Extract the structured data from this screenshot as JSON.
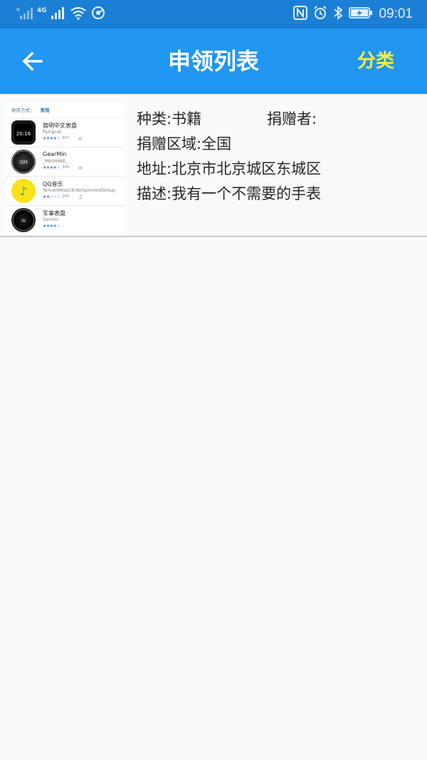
{
  "status_bar": {
    "network": "4G",
    "time": "09:01",
    "icons": [
      "signal-off-icon",
      "signal-icon",
      "wifi-icon",
      "hotspot-icon",
      "nfc-icon",
      "alarm-icon",
      "bluetooth-icon",
      "battery-charging-icon"
    ]
  },
  "app_bar": {
    "title": "申领列表",
    "category_label": "分类",
    "back_icon": "arrow-back-icon",
    "color": "#2196f3",
    "category_color": "#ffeb3b"
  },
  "list": [
    {
      "category": "种类:书籍",
      "donor": "捐赠者:",
      "region": "捐赠区域:全国",
      "address": "地址:北京市北京城区东城区",
      "description": "描述:我有一个不需要的手表",
      "thumbnail": {
        "sort_label": "排序方式：",
        "sort_value": "常用",
        "apps": [
          {
            "name": "简明中文表盘",
            "developer": "flyingcat",
            "stars": "★★★★☆",
            "count": "447",
            "icon_text": "20:16"
          },
          {
            "name": "GearMin",
            "developer": "_MASHAKE_",
            "stars": "★★★★☆",
            "count": "300",
            "icon_text": "GM"
          },
          {
            "name": "QQ音乐",
            "developer": "TencentMusicEntertainmentGroup",
            "stars": "★★☆☆☆",
            "count": "245",
            "icon_text": "♪"
          },
          {
            "name": "军事表盘",
            "developer": "Garmin",
            "stars": "★★★★☆",
            "count": "",
            "icon_text": "W"
          }
        ]
      }
    }
  ]
}
